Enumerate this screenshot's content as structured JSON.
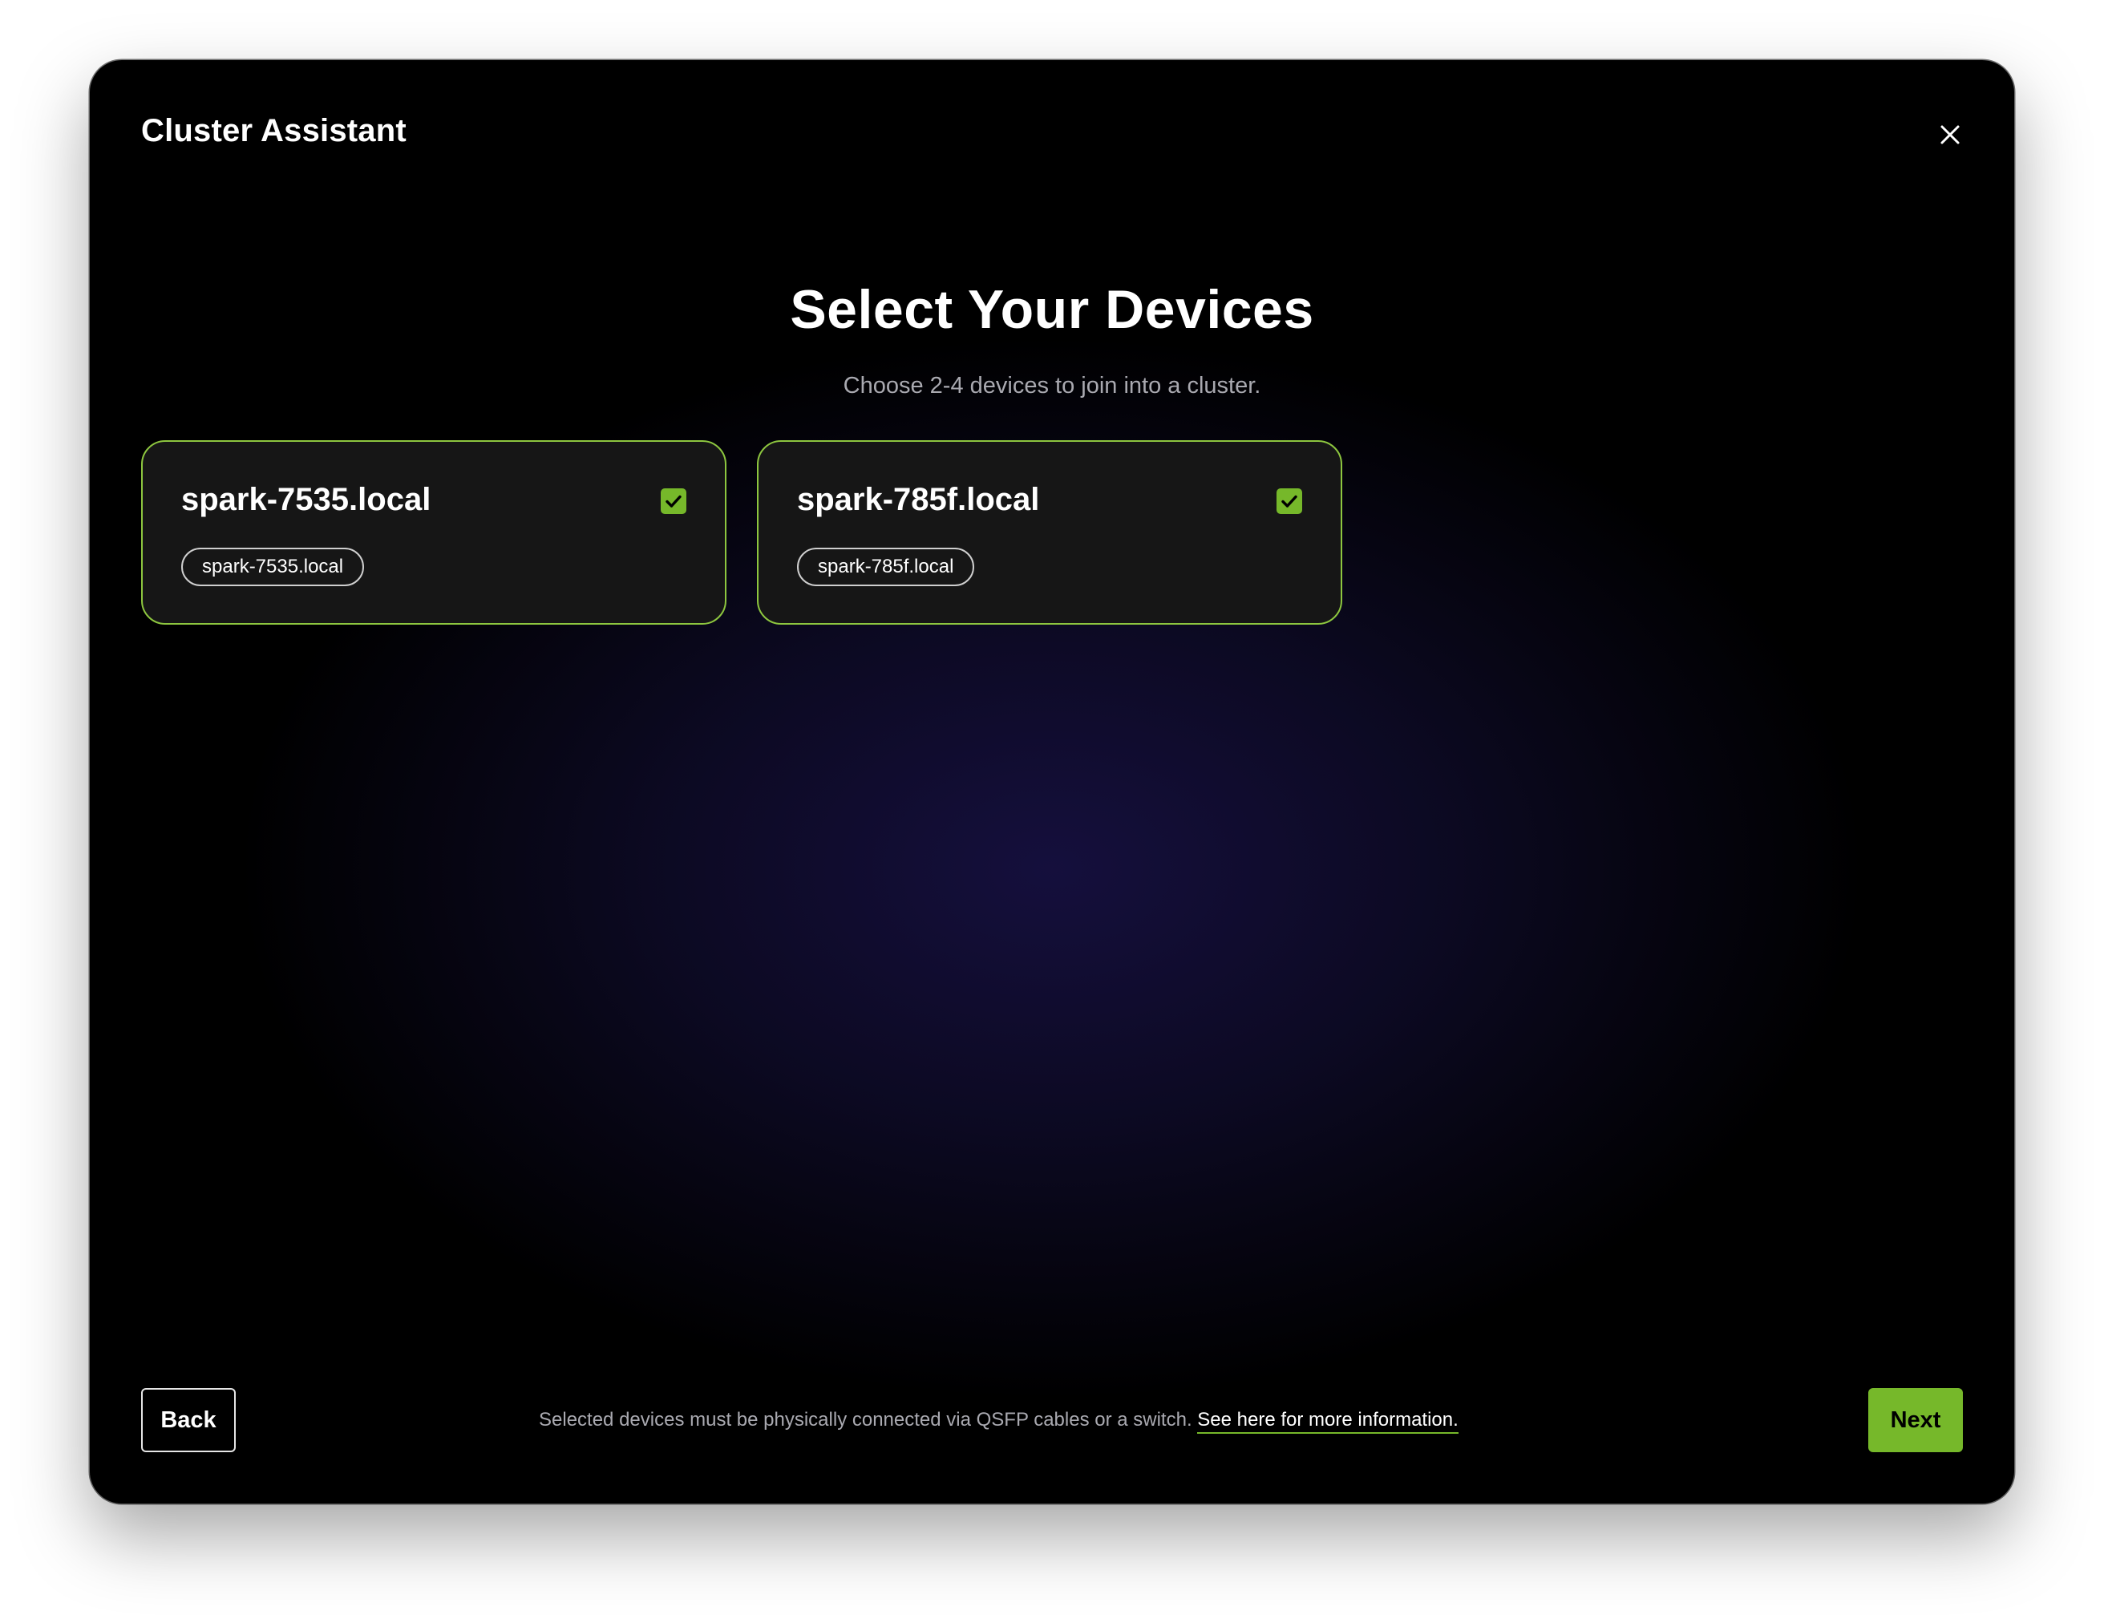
{
  "window": {
    "title": "Cluster Assistant",
    "close_icon": "close-icon"
  },
  "main": {
    "heading": "Select Your Devices",
    "subtitle": "Choose 2-4 devices to join into a cluster."
  },
  "devices": [
    {
      "name": "spark-7535.local",
      "tag": "spark-7535.local",
      "selected": true
    },
    {
      "name": "spark-785f.local",
      "tag": "spark-785f.local",
      "selected": true
    }
  ],
  "footer": {
    "back_label": "Back",
    "next_label": "Next",
    "note": "Selected devices must be physically connected via QSFP cables or a switch.",
    "link_text": "See here for more information."
  },
  "colors": {
    "accent": "#76b82a",
    "card_border": "#8dc63f",
    "background": "#000000",
    "card_background": "#161616"
  }
}
